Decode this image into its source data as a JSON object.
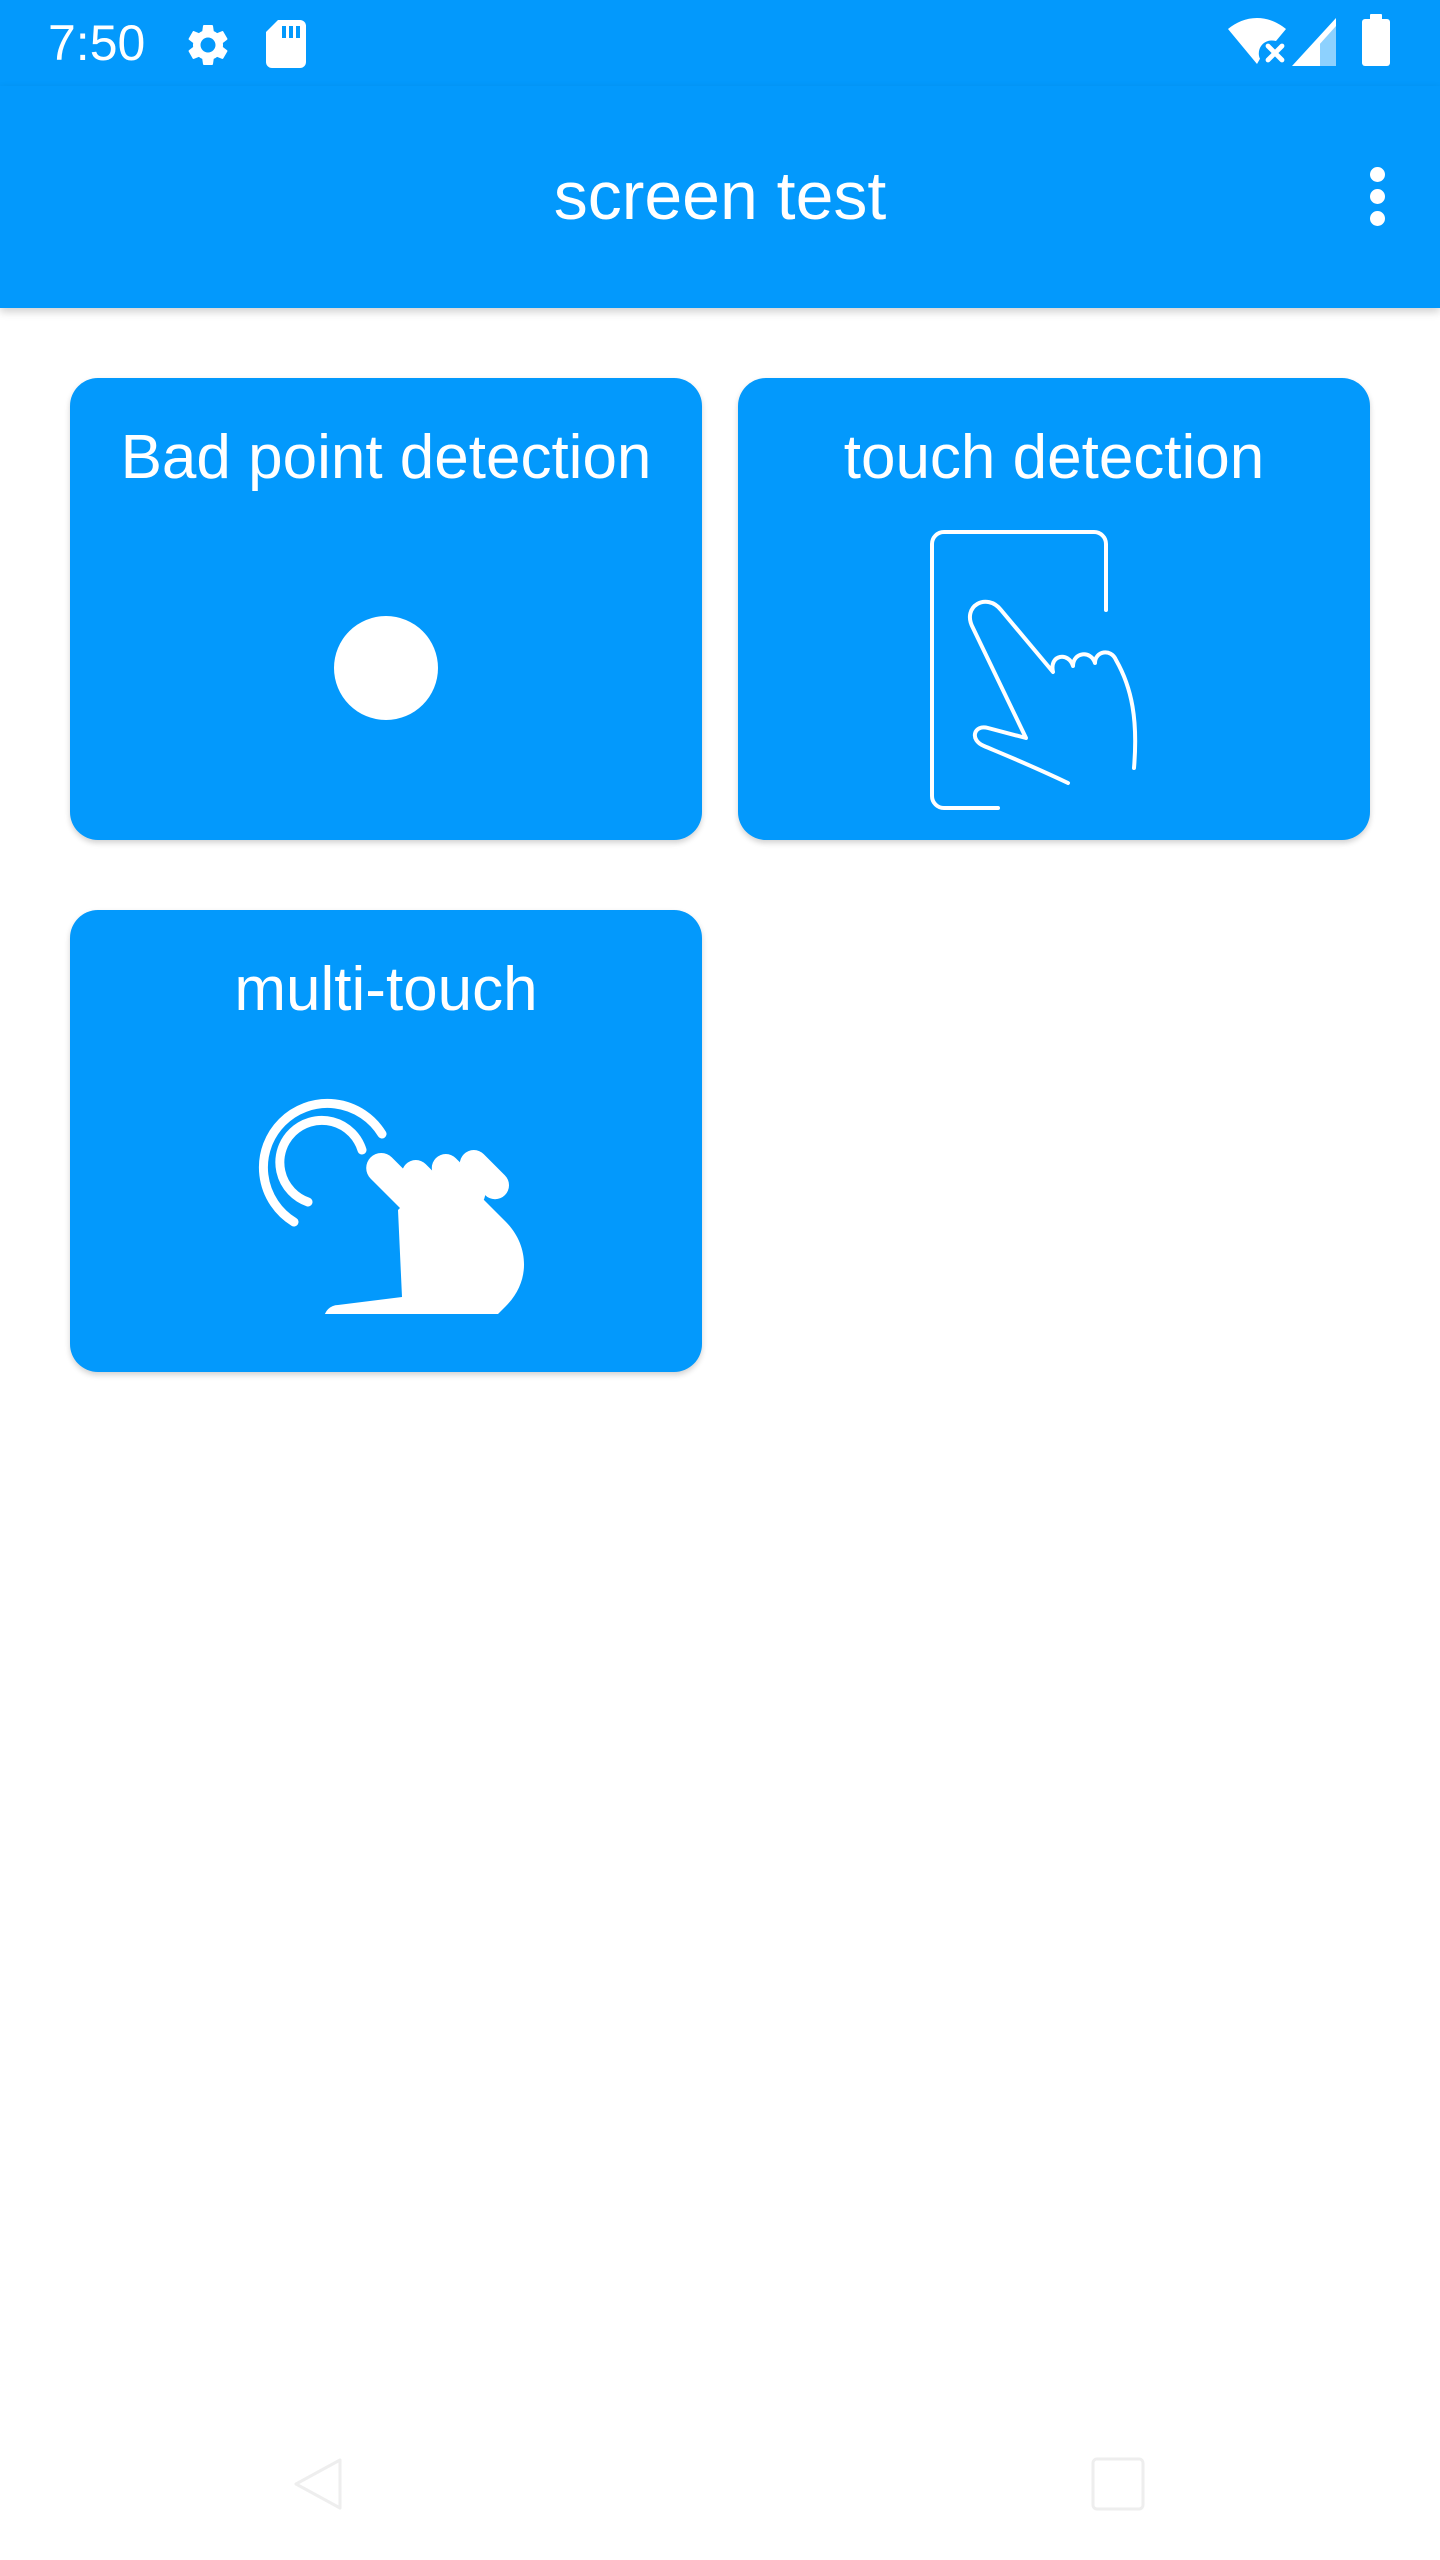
{
  "status_bar": {
    "time": "7:50",
    "icons": [
      "settings-gear-icon",
      "sd-card-icon",
      "wifi-icon",
      "signal-icon",
      "battery-icon"
    ]
  },
  "app_bar": {
    "title": "screen test",
    "menu_icon": "more-vert-icon"
  },
  "cards": [
    {
      "label": "Bad point detection",
      "icon": "dot-icon"
    },
    {
      "label": "touch detection",
      "icon": "finger-on-screen-icon"
    },
    {
      "label": "multi-touch",
      "icon": "tap-hand-icon"
    }
  ],
  "nav_bar": {
    "icons": [
      "back-icon",
      "recents-icon"
    ]
  },
  "colors": {
    "primary": "#0399FC",
    "on_primary": "#FFFFFF",
    "background": "#FFFFFF"
  }
}
